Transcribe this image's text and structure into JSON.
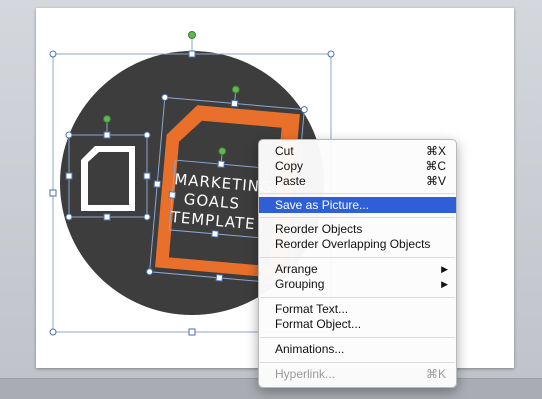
{
  "slide": {
    "text_box_lines": [
      "MARKETING",
      "GOALS",
      "TEMPLATE"
    ]
  },
  "colors": {
    "circle": "#3d3d3d",
    "accent": "#e8702a",
    "selection": "#2f5fd7",
    "handle": "#63b553"
  },
  "context_menu": {
    "cut": {
      "label": "Cut",
      "shortcut": "⌘X"
    },
    "copy": {
      "label": "Copy",
      "shortcut": "⌘C"
    },
    "paste": {
      "label": "Paste",
      "shortcut": "⌘V"
    },
    "save_as_picture": {
      "label": "Save as Picture..."
    },
    "reorder_objects": {
      "label": "Reorder Objects"
    },
    "reorder_overlapping": {
      "label": "Reorder Overlapping Objects"
    },
    "arrange": {
      "label": "Arrange",
      "submenu_icon": "triangle-right-icon"
    },
    "grouping": {
      "label": "Grouping",
      "submenu_icon": "triangle-right-icon"
    },
    "format_text": {
      "label": "Format Text..."
    },
    "format_object": {
      "label": "Format Object..."
    },
    "animations": {
      "label": "Animations..."
    },
    "hyperlink": {
      "label": "Hyperlink...",
      "shortcut": "⌘K",
      "disabled": true
    }
  }
}
